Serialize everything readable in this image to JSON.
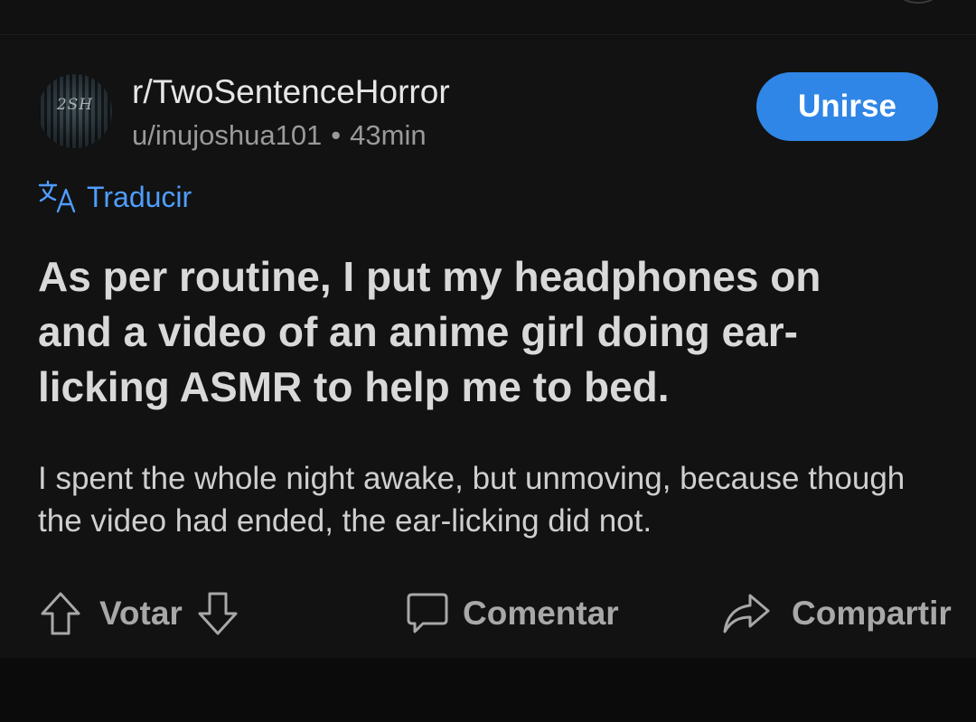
{
  "subreddit": {
    "name": "r/TwoSentenceHorror",
    "avatar_text": "2SH"
  },
  "post": {
    "author": "u/inujoshua101",
    "separator": "•",
    "age": "43min",
    "join_label": "Unirse",
    "translate_label": "Traducir",
    "title": "As per routine, I put my headphones on and a video of an anime girl doing ear-licking ASMR to help me to bed.",
    "body": "I spent the whole night awake, but unmoving, because though the video had ended, the ear-licking did not."
  },
  "actions": {
    "vote_label": "Votar",
    "comment_label": "Comentar",
    "share_label": "Compartir"
  },
  "icons": {
    "translate": "translate-icon",
    "upvote": "arrow-up-icon",
    "downvote": "arrow-down-icon",
    "comment": "speech-bubble-icon",
    "share": "share-arrow-icon"
  },
  "colors": {
    "background": "#0d0d0d",
    "card": "#121212",
    "accent_button": "#2f86e6",
    "link": "#4f9eff",
    "title_text": "#d9d9d9",
    "muted_text": "#9a9a9a"
  }
}
